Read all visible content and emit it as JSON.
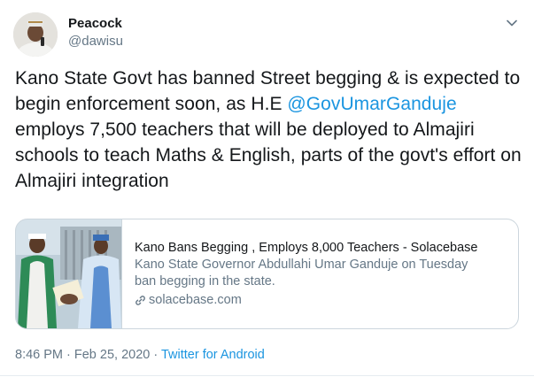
{
  "author": {
    "display_name": "Peacock",
    "handle": "@dawisu"
  },
  "tweet": {
    "text_before": "Kano State Govt has banned Street begging & is expected to begin enforcement soon, as H.E ",
    "mention": "@GovUmarGanduje",
    "text_after": " employs 7,500 teachers that will be deployed to Almajiri schools to teach Maths &  English, parts of the govt's effort on Almajiri integration"
  },
  "card": {
    "title": "Kano Bans Begging , Employs 8,000 Teachers - Solacebase",
    "description": "Kano State Governor Abdullahi Umar Ganduje on Tuesday ban begging in the state.",
    "domain": "solacebase.com"
  },
  "meta": {
    "timestamp": "8:46 PM · Feb 25, 2020",
    "separator": " · ",
    "source": "Twitter for Android"
  },
  "colors": {
    "link": "#1b95e0",
    "secondary_text": "#657786",
    "border": "#ccd6dd"
  },
  "icons": {
    "menu": "chevron-down-icon",
    "domain": "link-icon"
  }
}
